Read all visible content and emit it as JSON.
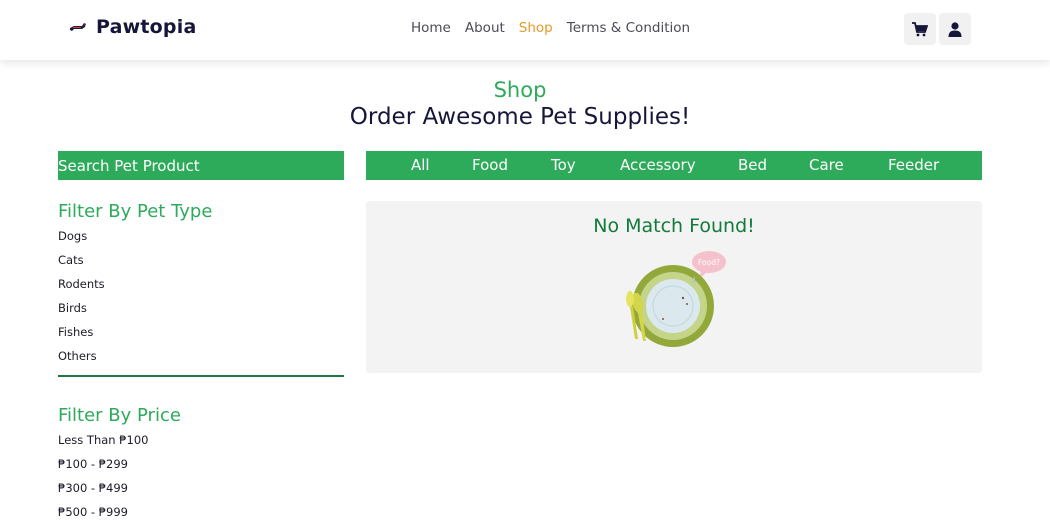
{
  "header": {
    "brand": "Pawtopia",
    "nav": [
      {
        "label": "Home",
        "active": false
      },
      {
        "label": "About",
        "active": false
      },
      {
        "label": "Shop",
        "active": true
      },
      {
        "label": "Terms & Condition",
        "active": false
      }
    ],
    "icons": {
      "cart": "cart-icon",
      "account": "user-icon"
    }
  },
  "hero": {
    "subtitle": "Shop",
    "title": "Order Awesome Pet Supplies!"
  },
  "search": {
    "placeholder": "Search Pet Product",
    "value": ""
  },
  "categories": [
    "All",
    "Food",
    "Toy",
    "Accessory",
    "Bed",
    "Care",
    "Feeder"
  ],
  "filters": {
    "pet_type": {
      "title": "Filter By Pet Type",
      "items": [
        "Dogs",
        "Cats",
        "Rodents",
        "Birds",
        "Fishes",
        "Others"
      ]
    },
    "price": {
      "title": "Filter By Price",
      "items": [
        "Less Than ₱100",
        "₱100 - ₱299",
        "₱300 - ₱499",
        "₱500 - ₱999"
      ]
    }
  },
  "results": {
    "message": "No Match Found!",
    "bubble_text": "Food?"
  },
  "colors": {
    "primary_green": "#2eaa5b",
    "dark_green": "#127a3a",
    "active_nav": "#e49a2a",
    "text_dark": "#16163a"
  }
}
